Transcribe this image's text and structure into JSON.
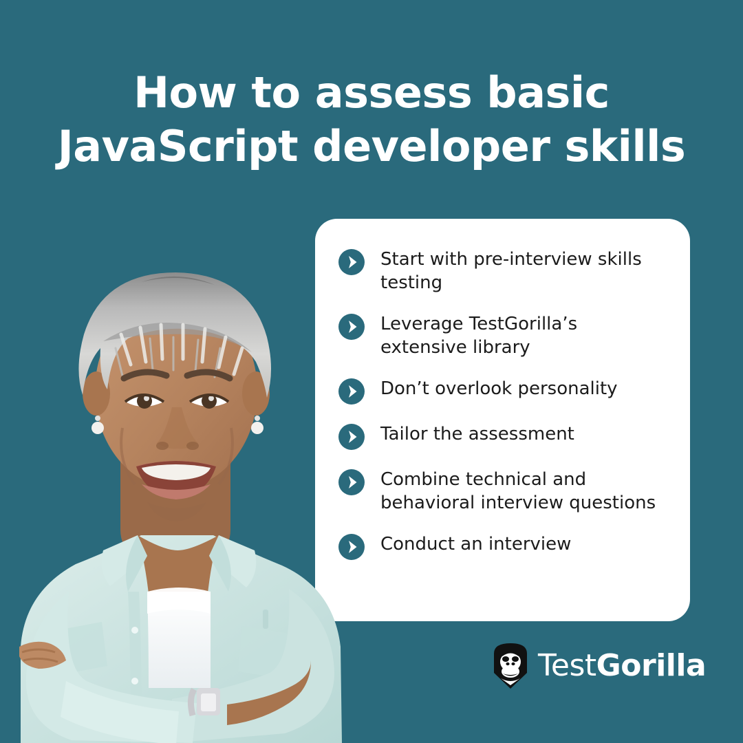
{
  "theme": {
    "background_teal": "#2a6a7c",
    "card_white": "#ffffff",
    "bullet_teal": "#2a6a7c",
    "text_dark": "#1b1b1b",
    "logo_black": "#111111",
    "shirt_mint": "#cfe6e3"
  },
  "title": {
    "line1": "How to assess basic",
    "line2": "JavaScript developer skills"
  },
  "card": {
    "items": [
      {
        "icon": "play-arrow-icon",
        "text": "Start with pre-interview skills testing"
      },
      {
        "icon": "play-arrow-icon",
        "text": "Leverage TestGorilla’s extensive library"
      },
      {
        "icon": "play-arrow-icon",
        "text": "Don’t overlook personality"
      },
      {
        "icon": "play-arrow-icon",
        "text": "Tailor the assessment"
      },
      {
        "icon": "play-arrow-icon",
        "text": "Combine technical and behavioral interview questions"
      },
      {
        "icon": "play-arrow-icon",
        "text": "Conduct an interview"
      }
    ]
  },
  "photo": {
    "alt": "Smiling older woman with short silver hair wearing a mint shirt, arms crossed",
    "icon": "person-photo"
  },
  "logo": {
    "mark_icon": "gorilla-shield-icon",
    "word_light": "Test",
    "word_bold": "Gorilla"
  }
}
